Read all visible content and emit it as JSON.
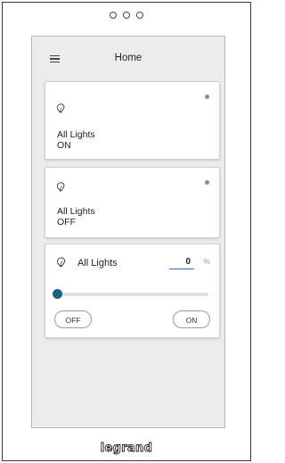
{
  "screen": {
    "title": "Home"
  },
  "cards": [
    {
      "label": "All Lights",
      "state": "ON"
    },
    {
      "label": "All Lights",
      "state": "OFF"
    }
  ],
  "dimmer": {
    "label": "All Lights",
    "level_value": "0",
    "level_unit": "%",
    "level_fraction": 0,
    "off_label": "OFF",
    "on_label": "ON"
  },
  "brand": {
    "name": "legrand"
  },
  "icons": {
    "menu": "hamburger-menu-icon",
    "bulb": "light-bulb-icon",
    "status": "status-dot-icon"
  },
  "colors": {
    "accent": "#1d5f86",
    "input_underline": "#2e6bbf",
    "background": "#ececec",
    "card": "#ffffff"
  }
}
